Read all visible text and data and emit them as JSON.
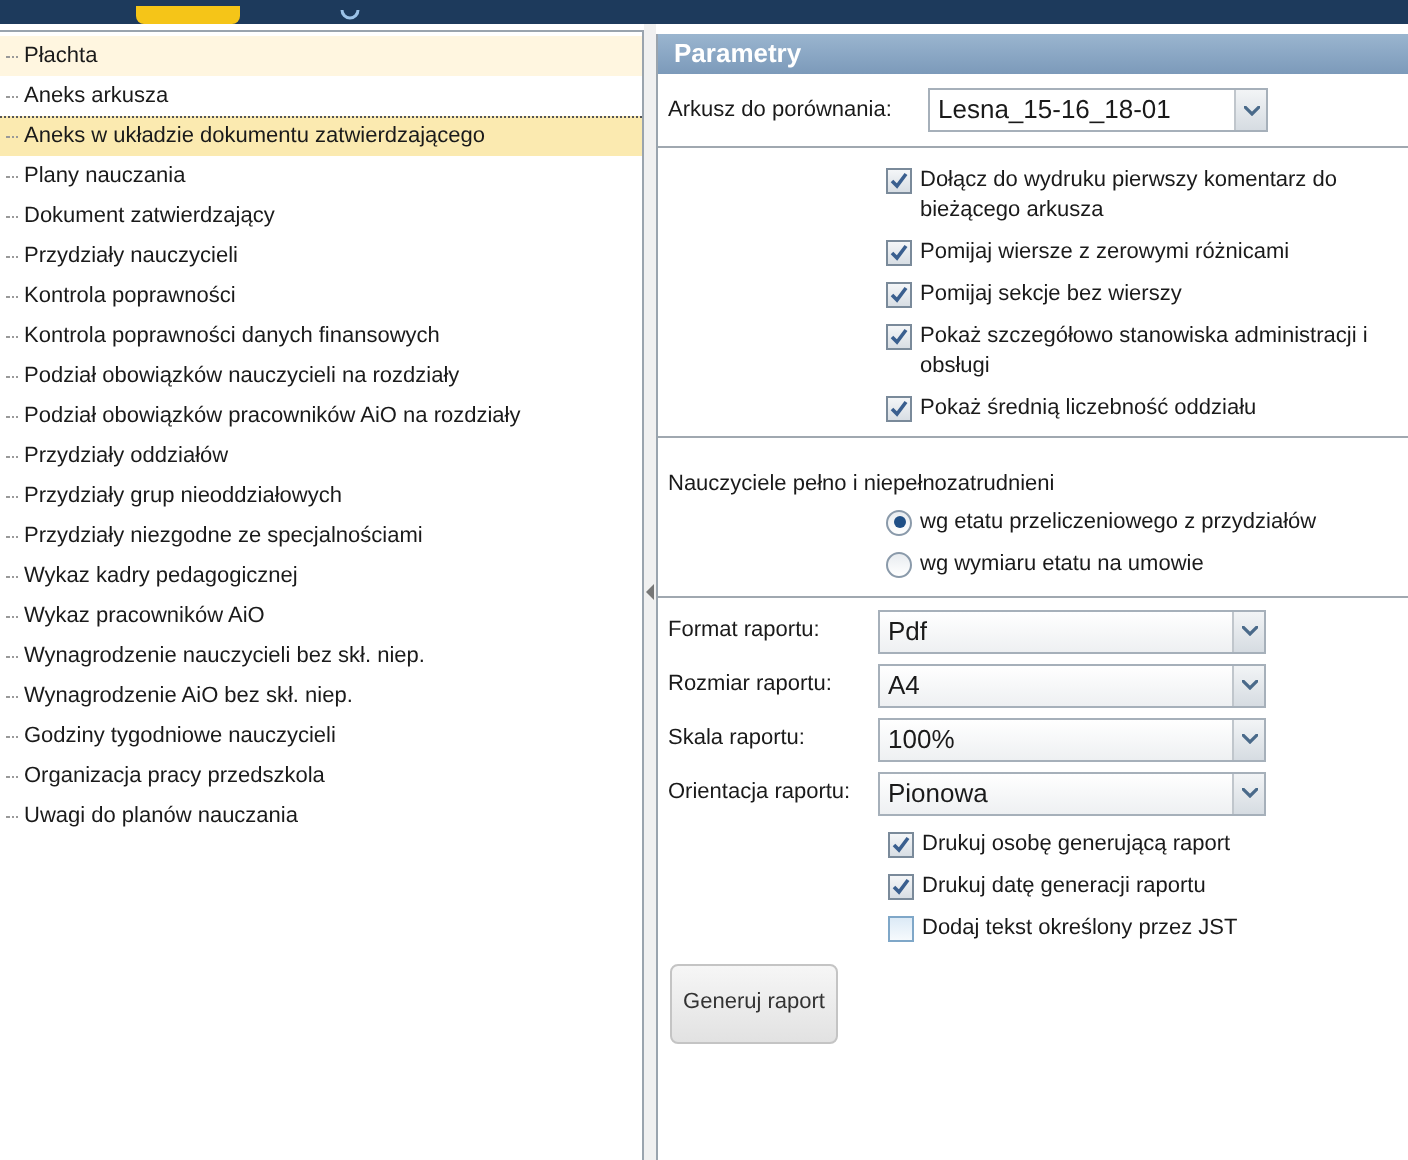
{
  "sidebar": {
    "items": [
      {
        "label": "Płachta",
        "selected": false,
        "highlighted": true
      },
      {
        "label": "Aneks arkusza",
        "selected": false,
        "highlighted": false
      },
      {
        "label": "Aneks w układzie dokumentu zatwierdzającego",
        "selected": true,
        "highlighted": false
      },
      {
        "label": "Plany nauczania",
        "selected": false,
        "highlighted": false
      },
      {
        "label": "Dokument zatwierdzający",
        "selected": false,
        "highlighted": false
      },
      {
        "label": "Przydziały nauczycieli",
        "selected": false,
        "highlighted": false
      },
      {
        "label": "Kontrola poprawności",
        "selected": false,
        "highlighted": false
      },
      {
        "label": "Kontrola poprawności danych finansowych",
        "selected": false,
        "highlighted": false
      },
      {
        "label": "Podział obowiązków nauczycieli na rozdziały",
        "selected": false,
        "highlighted": false
      },
      {
        "label": "Podział obowiązków pracowników AiO na rozdziały",
        "selected": false,
        "highlighted": false
      },
      {
        "label": "Przydziały oddziałów",
        "selected": false,
        "highlighted": false
      },
      {
        "label": "Przydziały grup nieoddziałowych",
        "selected": false,
        "highlighted": false
      },
      {
        "label": "Przydziały niezgodne ze specjalnościami",
        "selected": false,
        "highlighted": false
      },
      {
        "label": "Wykaz kadry pedagogicznej",
        "selected": false,
        "highlighted": false
      },
      {
        "label": "Wykaz pracowników AiO",
        "selected": false,
        "highlighted": false
      },
      {
        "label": "Wynagrodzenie nauczycieli bez skł. niep.",
        "selected": false,
        "highlighted": false
      },
      {
        "label": "Wynagrodzenie AiO bez skł. niep.",
        "selected": false,
        "highlighted": false
      },
      {
        "label": "Godziny tygodniowe nauczycieli",
        "selected": false,
        "highlighted": false
      },
      {
        "label": "Organizacja pracy przedszkola",
        "selected": false,
        "highlighted": false
      },
      {
        "label": "Uwagi do planów nauczania",
        "selected": false,
        "highlighted": false
      }
    ]
  },
  "panel": {
    "title": "Parametry",
    "compare_sheet": {
      "label": "Arkusz do porównania:",
      "value": "Lesna_15-16_18-01"
    },
    "options": [
      {
        "label": "Dołącz do wydruku pierwszy komentarz do bieżącego arkusza",
        "checked": true
      },
      {
        "label": "Pomijaj wiersze z zerowymi różnicami",
        "checked": true
      },
      {
        "label": "Pomijaj sekcje bez wierszy",
        "checked": true
      },
      {
        "label": "Pokaż szczegółowo stanowiska administracji i obsługi",
        "checked": true
      },
      {
        "label": "Pokaż średnią liczebność oddziału",
        "checked": true
      }
    ],
    "teachers": {
      "label": "Nauczyciele pełno i niepełnozatrudnieni",
      "choices": [
        {
          "label": "wg etatu przeliczeniowego z przydziałów",
          "selected": true
        },
        {
          "label": "wg wymiaru etatu na umowie",
          "selected": false
        }
      ]
    },
    "report_fields": [
      {
        "label": "Format raportu:",
        "value": "Pdf"
      },
      {
        "label": "Rozmiar raportu:",
        "value": "A4"
      },
      {
        "label": "Skala raportu:",
        "value": "100%"
      },
      {
        "label": "Orientacja raportu:",
        "value": "Pionowa"
      }
    ],
    "print_options": [
      {
        "label": "Drukuj osobę generującą raport",
        "checked": true
      },
      {
        "label": "Drukuj datę generacji raportu",
        "checked": true
      },
      {
        "label": "Dodaj tekst określony przez JST",
        "checked": false
      }
    ],
    "button": "Generuj raport"
  }
}
